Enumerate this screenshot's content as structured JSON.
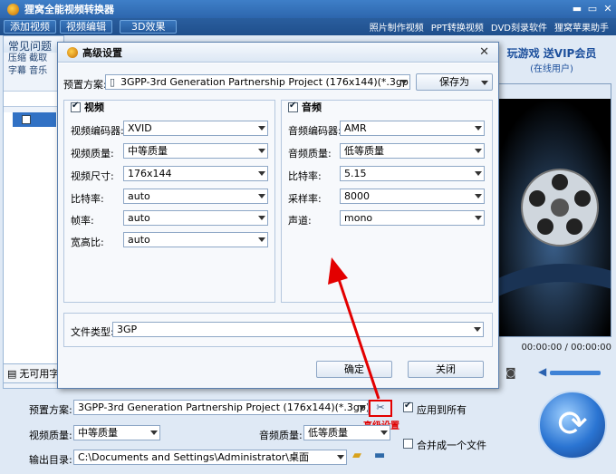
{
  "app": {
    "title": "狸窝全能视频转换器",
    "win_controls": [
      "▬",
      "▭",
      "✕"
    ]
  },
  "toolbar": {
    "buttons": [
      "添加视频",
      "视频编辑",
      "3D效果"
    ],
    "links": [
      "照片制作视频",
      "PPT转换视频",
      "DVD刻录软件",
      "狸窝苹果助手"
    ]
  },
  "left_panel": {
    "header": "常见问题",
    "sub1": "压缩  截取",
    "sub2": "字幕  音乐",
    "bottom_label": "无可用字"
  },
  "ad": {
    "main": "玩游戏  送VIP会员",
    "sub": "(在线用户)"
  },
  "player": {
    "time": "00:00:00 / 00:00:00"
  },
  "dialog": {
    "title": "高级设置",
    "preset_label": "预置方案:",
    "preset_value": "3GPP-3rd Generation Partnership Project (176x144)(*.3gp)",
    "save_as": "保存为",
    "video": {
      "header": "视频",
      "rows": [
        {
          "label": "视频编码器:",
          "value": "XVID"
        },
        {
          "label": "视频质量:",
          "value": "中等质量"
        },
        {
          "label": "视频尺寸:",
          "value": "176x144"
        },
        {
          "label": "比特率:",
          "value": "auto"
        },
        {
          "label": "帧率:",
          "value": "auto"
        },
        {
          "label": "宽高比:",
          "value": "auto"
        }
      ]
    },
    "audio": {
      "header": "音频",
      "rows": [
        {
          "label": "音频编码器:",
          "value": "AMR"
        },
        {
          "label": "音频质量:",
          "value": "低等质量"
        },
        {
          "label": "比特率:",
          "value": "5.15"
        },
        {
          "label": "采样率:",
          "value": "8000"
        },
        {
          "label": "声道:",
          "value": "mono"
        }
      ]
    },
    "file_type_label": "文件类型:",
    "file_type_value": "3GP",
    "ok": "确定",
    "close": "关闭"
  },
  "bottom": {
    "preset_label": "预置方案:",
    "preset_value": "3GPP-3rd Generation Partnership Project (176x144)(*.3gp)",
    "apply_all": "应用到所有",
    "advanced_caption": "高级设置",
    "video_quality_label": "视频质量:",
    "video_quality_value": "中等质量",
    "audio_quality_label": "音频质量:",
    "audio_quality_value": "低等质量",
    "output_label": "输出目录:",
    "output_value": "C:\\Documents and Settings\\Administrator\\桌面",
    "merge": "合并成一个文件"
  },
  "colors": {
    "accent": "#2f6aa8",
    "highlight": "#e30000"
  }
}
